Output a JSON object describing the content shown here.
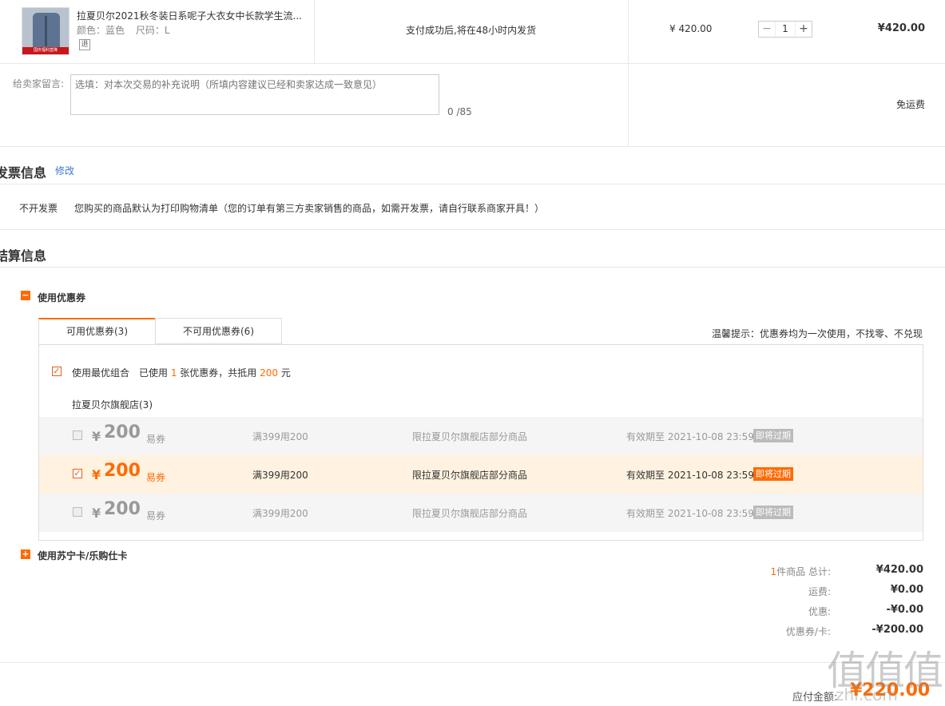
{
  "product": {
    "name": "拉夏贝尔2021秋冬装日系呢子大衣女中长款学生流...",
    "attr_color_label": "颜色：蓝色",
    "attr_size_label": "尺码：L",
    "refund_badge": "退",
    "thumb_strip": "国庆福利直降",
    "shipping_note": "支付成功后,将在48小时内发货",
    "unit_price": "¥ 420.00",
    "quantity": "1",
    "minus": "−",
    "plus": "+",
    "subtotal": "¥420.00"
  },
  "message": {
    "label": "给卖家留言:",
    "placeholder": "选填：对本次交易的补充说明（所填内容建议已经和卖家达成一致意见）",
    "count": "0 /85",
    "shipping_fee": "免运费"
  },
  "invoice": {
    "title": "发票信息",
    "modify": "修改",
    "type": "不开发票",
    "desc": "您购买的商品默认为打印购物清单（您的订单有第三方卖家销售的商品，如需开发票，请自行联系商家开具！）"
  },
  "settlement": {
    "title": "结算信息",
    "coupon_toggle_icon": "−",
    "coupon_section_label": "使用优惠券",
    "tabs": [
      {
        "label": "可用优惠券(3)"
      },
      {
        "label": "不可用优惠券(6)"
      }
    ],
    "tip": "温馨提示：优惠券均为一次使用，不找零、不兑现",
    "best_combo": {
      "prefix": "使用最优组合　已使用 ",
      "count": "1",
      "mid": " 张优惠券，共抵用 ",
      "amount": "200",
      "suffix": " 元"
    },
    "store_name": "拉夏贝尔旗舰店(3)",
    "coupons": [
      {
        "currency": "¥",
        "amount": "200",
        "kind": "易券",
        "condition": "满399用200",
        "scope": "限拉夏贝尔旗舰店部分商品",
        "expire": "有效期至 2021-10-08 23:59",
        "tag": "即将过期",
        "selected": false
      },
      {
        "currency": "¥",
        "amount": "200",
        "kind": "易券",
        "condition": "满399用200",
        "scope": "限拉夏贝尔旗舰店部分商品",
        "expire": "有效期至 2021-10-08 23:59",
        "tag": "即将过期",
        "selected": true
      },
      {
        "currency": "¥",
        "amount": "200",
        "kind": "易券",
        "condition": "满399用200",
        "scope": "限拉夏贝尔旗舰店部分商品",
        "expire": "有效期至 2021-10-08 23:59",
        "tag": "即将过期",
        "selected": false
      }
    ],
    "card_toggle_icon": "+",
    "card_section_label": "使用苏宁卡/乐购仕卡"
  },
  "summary": {
    "item_count": "1",
    "item_label": "件商品 总计:",
    "total": "¥420.00",
    "shipping_label": "运费:",
    "shipping": "¥0.00",
    "discount_label": "优惠:",
    "discount": "-¥0.00",
    "coupon_label": "优惠券/卡:",
    "coupon": "-¥200.00",
    "due_label": "应付金额:",
    "due": "¥220.00"
  },
  "watermark": {
    "text": "值值值",
    "sub": "zhi.com"
  },
  "colors": {
    "accent": "#ff6a00",
    "link": "#3a7ac8",
    "selected_row_bg": "#fff2e0"
  }
}
